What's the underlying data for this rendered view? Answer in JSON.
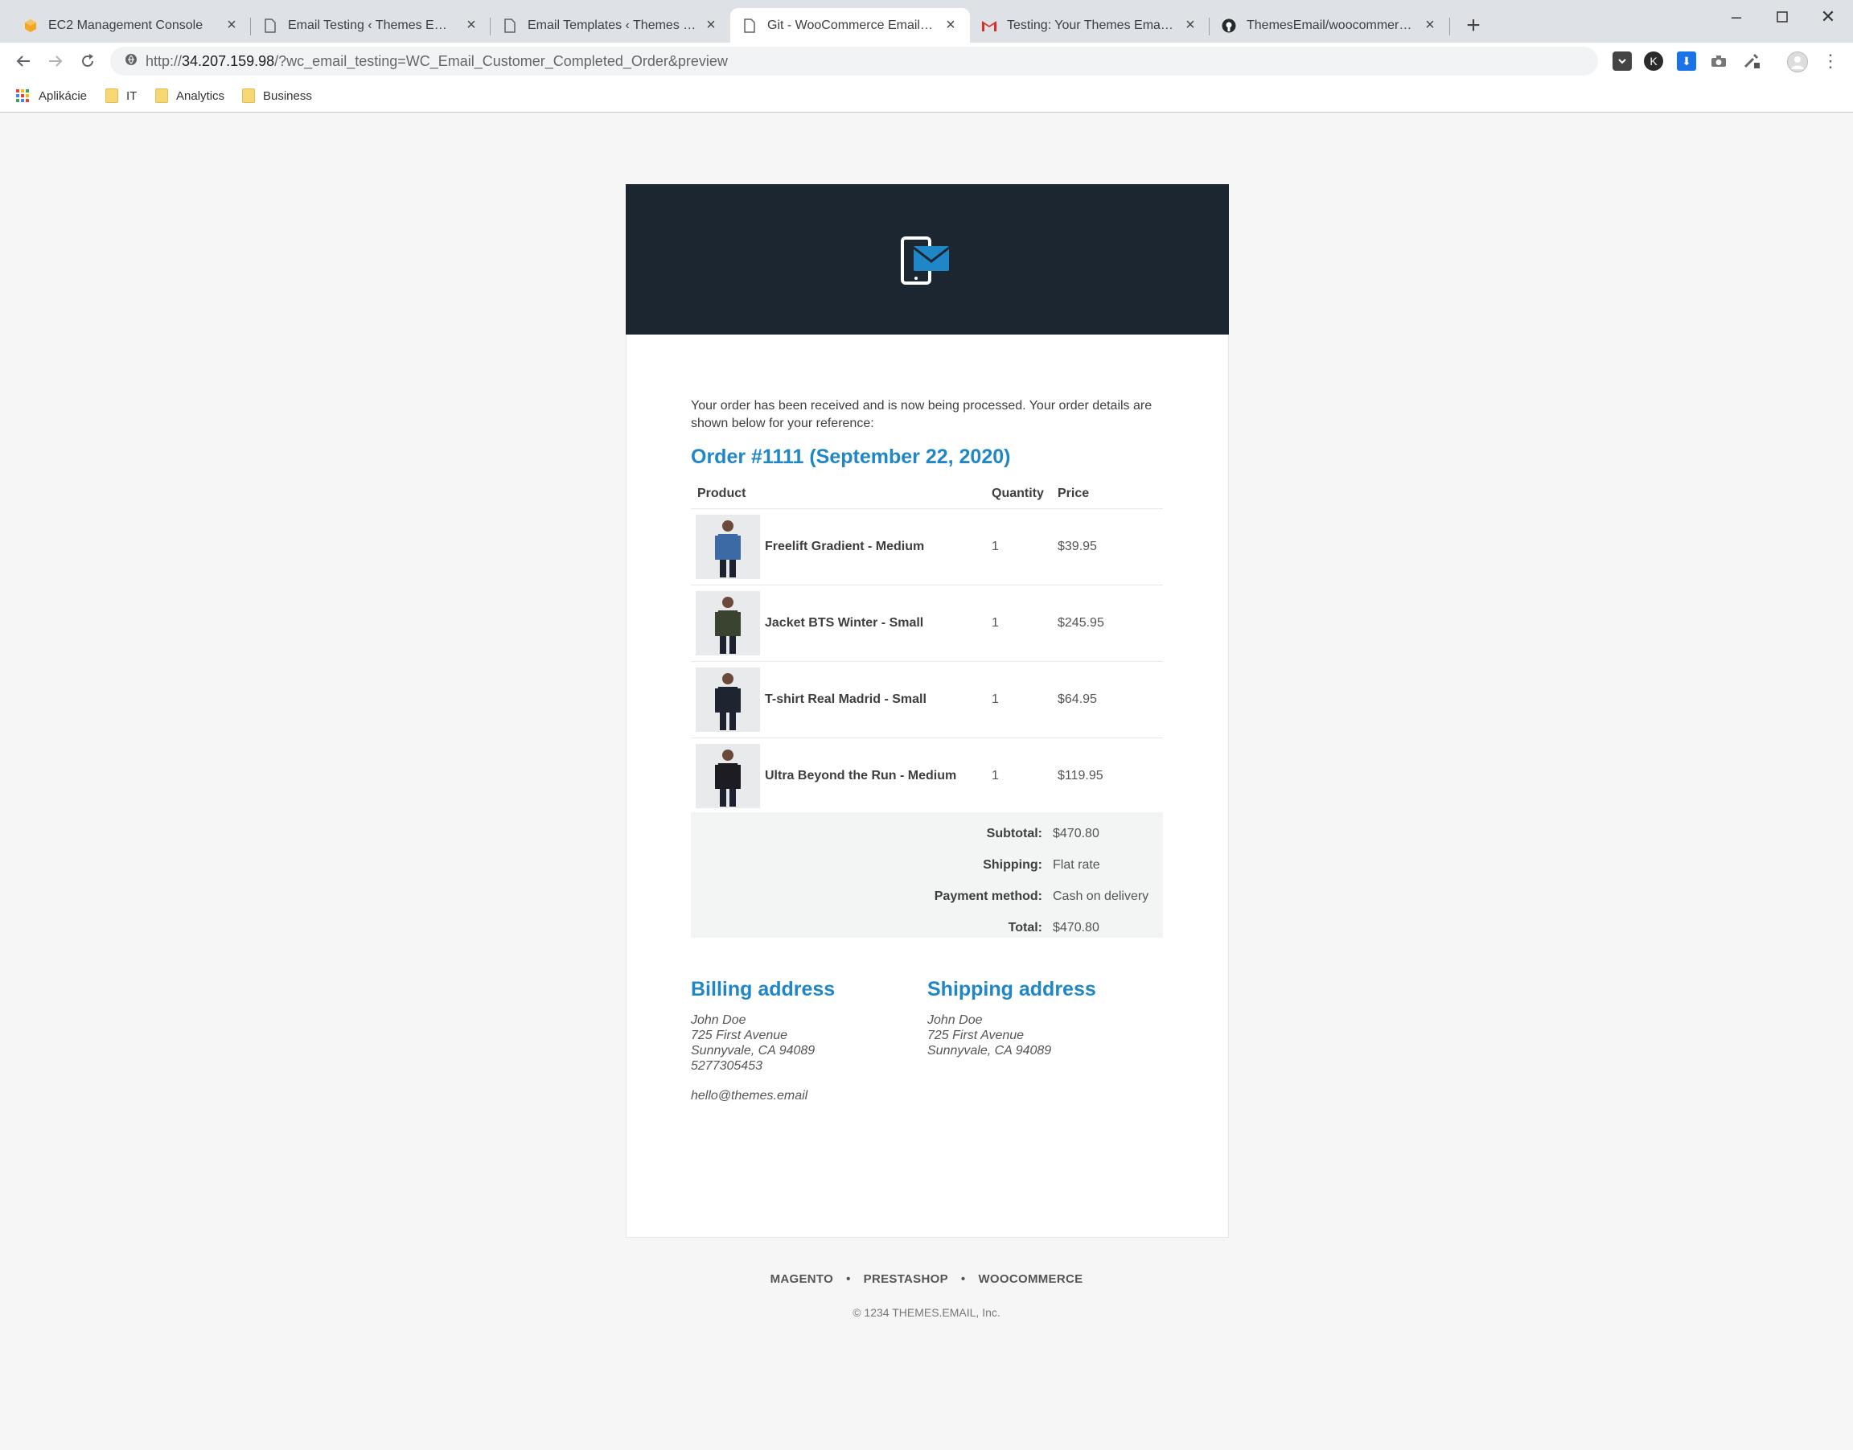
{
  "browser": {
    "tabs": [
      {
        "title": "EC2 Management Console",
        "icon": "aws-box-icon"
      },
      {
        "title": "Email Testing ‹ Themes Email — W",
        "icon": "page-icon"
      },
      {
        "title": "Email Templates ‹ Themes Email –",
        "icon": "page-icon"
      },
      {
        "title": "Git - WooCommerce Email Temp",
        "icon": "page-icon",
        "active": true
      },
      {
        "title": "Testing: Your Themes Email order",
        "icon": "gmail-icon"
      },
      {
        "title": "ThemesEmail/woocommerce-em",
        "icon": "github-icon"
      }
    ],
    "url_host": "34.207.159.98",
    "url_prefix": "http://",
    "url_path": "/?wc_email_testing=WC_Email_Customer_Completed_Order&preview",
    "bookmarks": [
      "Aplikácie",
      "IT",
      "Analytics",
      "Business"
    ]
  },
  "email": {
    "intro": "Your order has been received and is now being processed. Your order details are shown below for your reference:",
    "order_title": "Order #1111 (September 22, 2020)",
    "columns": {
      "product": "Product",
      "quantity": "Quantity",
      "price": "Price"
    },
    "items": [
      {
        "name": "Freelift Gradient - Medium",
        "qty": "1",
        "price": "$39.95",
        "color": "#3b6aa5"
      },
      {
        "name": "Jacket BTS Winter - Small",
        "qty": "1",
        "price": "$245.95",
        "color": "#3a4230"
      },
      {
        "name": "T-shirt Real Madrid - Small",
        "qty": "1",
        "price": "$64.95",
        "color": "#1f2530"
      },
      {
        "name": "Ultra Beyond the Run - Medium",
        "qty": "1",
        "price": "$119.95",
        "color": "#1c1c22"
      }
    ],
    "totals": [
      {
        "label": "Subtotal:",
        "value": "$470.80"
      },
      {
        "label": "Shipping:",
        "value": "Flat rate"
      },
      {
        "label": "Payment method:",
        "value": "Cash on delivery"
      },
      {
        "label": "Total:",
        "value": "$470.80"
      }
    ],
    "billing": {
      "title": "Billing address",
      "lines": [
        "John Doe",
        "725 First Avenue",
        "Sunnyvale, CA 94089",
        "5277305453"
      ],
      "email": "hello@themes.email"
    },
    "shipping": {
      "title": "Shipping address",
      "lines": [
        "John Doe",
        "725 First Avenue",
        "Sunnyvale, CA 94089"
      ]
    },
    "footer_links": [
      "MAGENTO",
      "PRESTASHOP",
      "WOOCOMMERCE"
    ],
    "footer_separator": "•",
    "copyright": "© 1234 THEMES.EMAIL, Inc."
  },
  "colors": {
    "header_bg": "#1b2630",
    "accent": "#1f86c8",
    "page_bg": "#f5f6f5"
  }
}
